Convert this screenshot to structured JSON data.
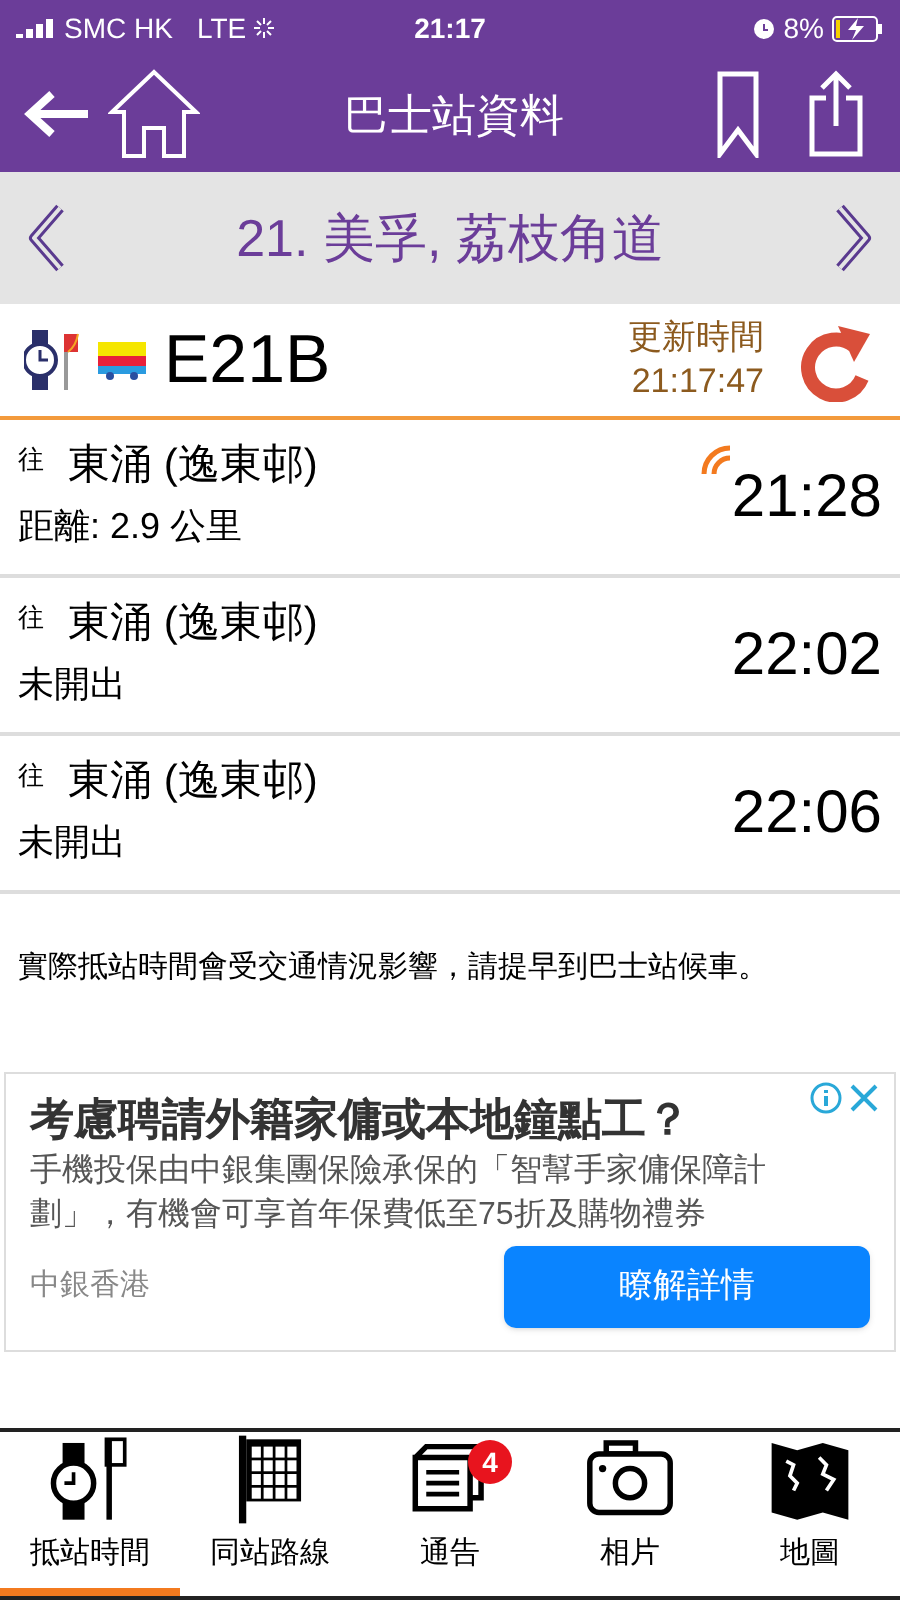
{
  "status_bar": {
    "carrier": "SMC HK",
    "network": "LTE",
    "time": "21:17",
    "battery": "8%"
  },
  "header": {
    "title": "巴士站資料"
  },
  "stop": {
    "name": "21. 美孚, 荔枝角道"
  },
  "route": {
    "number": "E21B",
    "update_label": "更新時間",
    "update_time": "21:17:47"
  },
  "arrivals": [
    {
      "prefix": "往",
      "destination": "東涌 (逸東邨)",
      "detail": "距離: 2.9 公里",
      "time": "21:28",
      "realtime": true
    },
    {
      "prefix": "往",
      "destination": "東涌 (逸東邨)",
      "detail": "未開出",
      "time": "22:02",
      "realtime": false
    },
    {
      "prefix": "往",
      "destination": "東涌 (逸東邨)",
      "detail": "未開出",
      "time": "22:06",
      "realtime": false
    }
  ],
  "notice": "實際抵站時間會受交通情況影響，請提早到巴士站候車。",
  "ad": {
    "headline": "考慮聘請外籍家傭或本地鐘點工？",
    "body": "手機投保由中銀集團保險承保的「智幫手家傭保障計劃」，有機會可享首年保費低至75折及購物禮券",
    "advertiser": "中銀香港",
    "cta": "瞭解詳情"
  },
  "tabs": [
    {
      "kind": "eta",
      "label": "抵站時間",
      "selected": true
    },
    {
      "kind": "routes",
      "label": "同站路線",
      "selected": false
    },
    {
      "kind": "notice",
      "label": "通告",
      "selected": false,
      "badge": "4"
    },
    {
      "kind": "photo",
      "label": "相片",
      "selected": false
    },
    {
      "kind": "map",
      "label": "地圖",
      "selected": false
    }
  ]
}
